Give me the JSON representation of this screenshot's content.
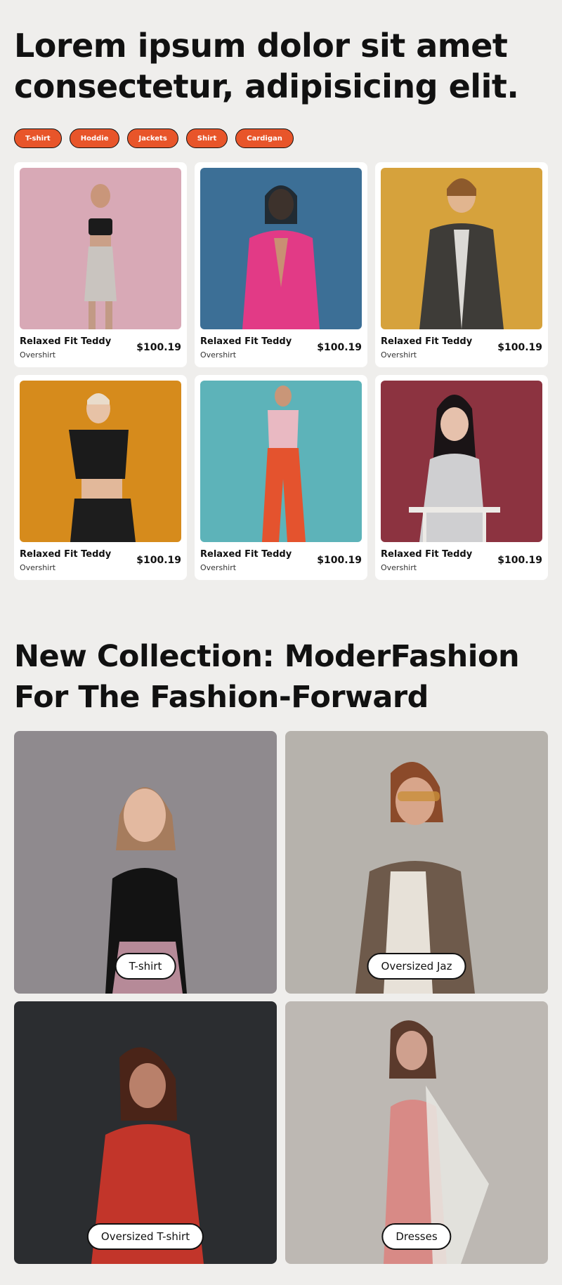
{
  "hero": {
    "title_line1": "Lorem ipsum dolor sit amet",
    "title_line2": "consectetur, adipisicing elit."
  },
  "filters": [
    "T-shirt",
    "Hoddie",
    "Jackets",
    "Shirt",
    "Cardigan"
  ],
  "products": [
    {
      "name": "Relaxed Fit Teddy",
      "sub": "Overshirt",
      "price": "$100.19",
      "bg": "#d8a9b6"
    },
    {
      "name": "Relaxed Fit Teddy",
      "sub": "Overshirt",
      "price": "$100.19",
      "bg": "#3c6f96"
    },
    {
      "name": "Relaxed Fit Teddy",
      "sub": "Overshirt",
      "price": "$100.19",
      "bg": "#d6a23c"
    },
    {
      "name": "Relaxed Fit Teddy",
      "sub": "Overshirt",
      "price": "$100.19",
      "bg": "#d68b1c"
    },
    {
      "name": "Relaxed Fit Teddy",
      "sub": "Overshirt",
      "price": "$100.19",
      "bg": "#5db3b9"
    },
    {
      "name": "Relaxed Fit Teddy",
      "sub": "Overshirt",
      "price": "$100.19",
      "bg": "#8c3340"
    }
  ],
  "collection": {
    "title_line1": "New Collection: ModerFashion",
    "title_line2": "For The Fashion-Forward",
    "items": [
      {
        "label": "T-shirt",
        "bg": "#8f8a8e"
      },
      {
        "label": "Oversized Jaz",
        "bg": "#b6b2ac"
      },
      {
        "label": "Oversized T-shirt",
        "bg": "#2b2d30"
      },
      {
        "label": "Dresses",
        "bg": "#bdb8b3"
      }
    ]
  },
  "colors": {
    "accent": "#e8552a",
    "page_bg": "#efeeec"
  }
}
